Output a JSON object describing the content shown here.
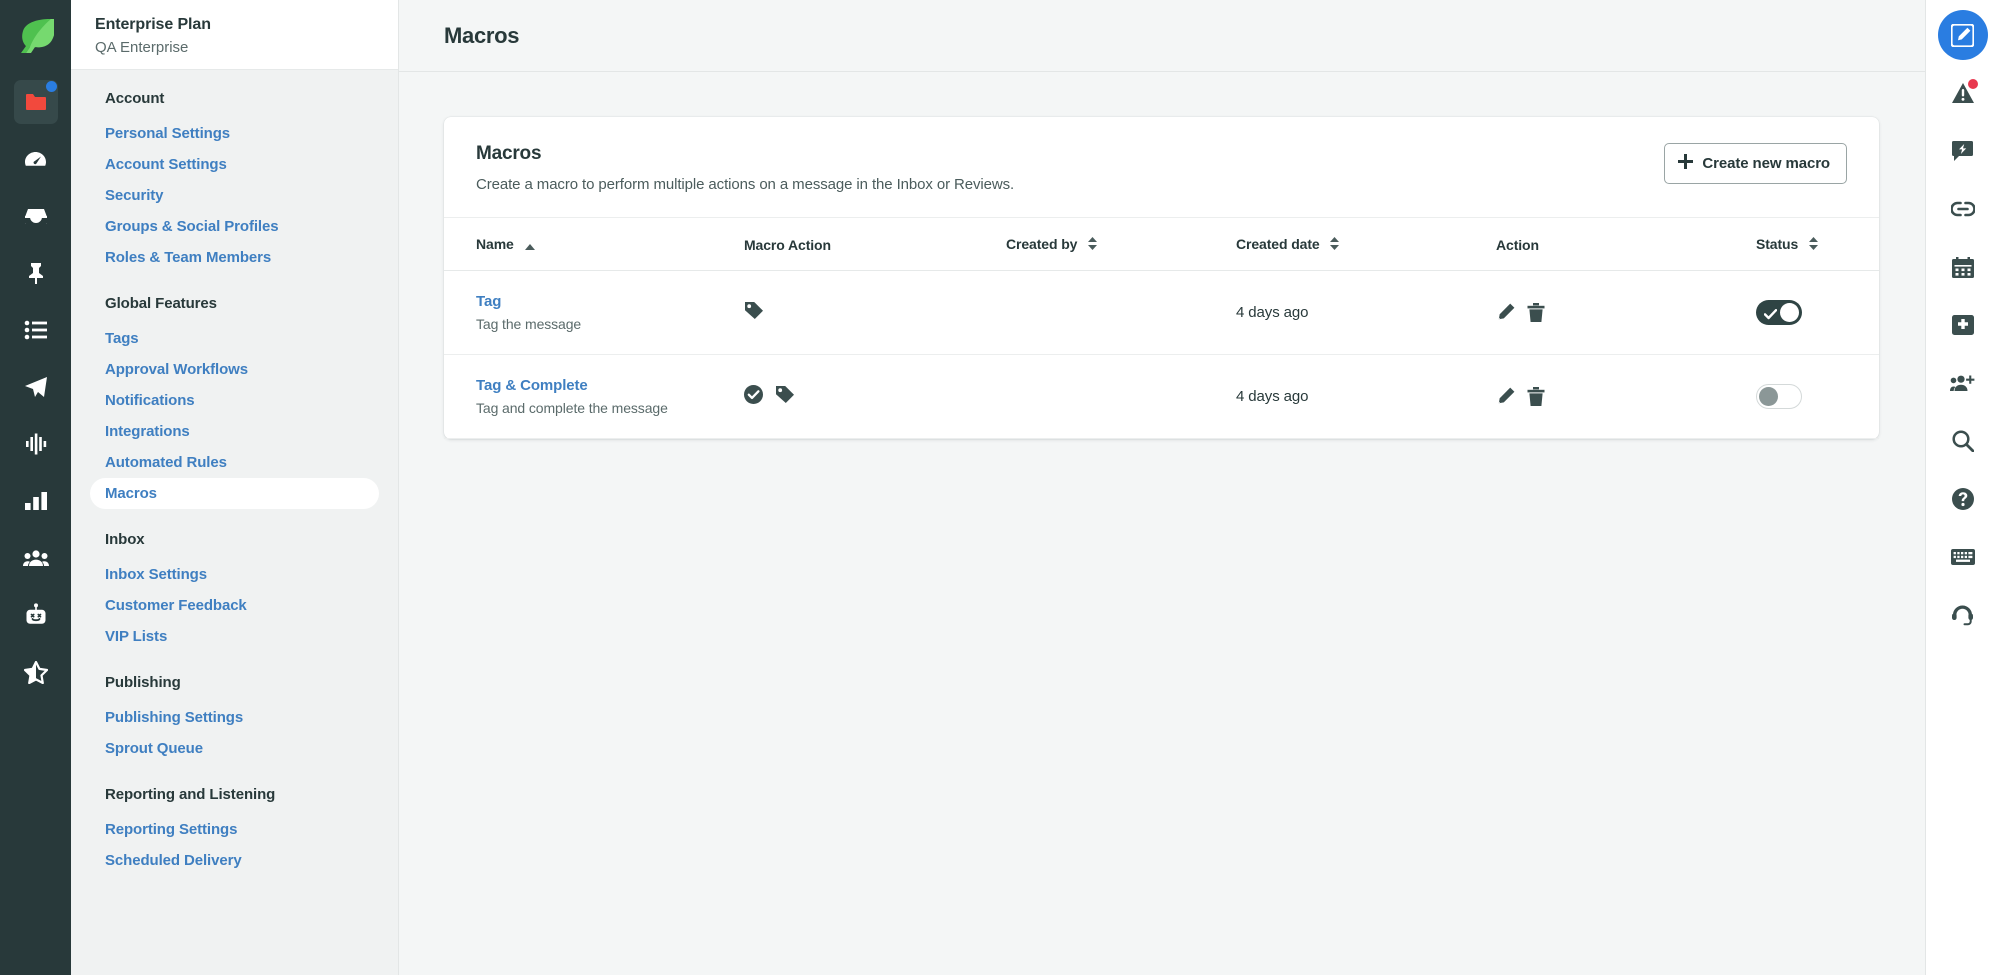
{
  "brand": {
    "logo_icon": "sprout-leaf-logo",
    "leaf_color": "#59cb59",
    "rail_bg": "#28393a",
    "link_color": "#3f7fc1",
    "accent_blue": "#2a7de1",
    "badge_red": "#e8384f"
  },
  "left_rail": {
    "items": [
      {
        "icon": "folder-icon",
        "name": "compose-folder",
        "active": true,
        "badge": "blue-dot"
      },
      {
        "icon": "speedometer-icon",
        "name": "dashboard",
        "active": false
      },
      {
        "icon": "inbox-icon",
        "name": "smart-inbox",
        "active": false
      },
      {
        "icon": "pin-icon",
        "name": "pinned",
        "active": false
      },
      {
        "icon": "list-icon",
        "name": "tasks",
        "active": false
      },
      {
        "icon": "paper-plane-icon",
        "name": "publishing",
        "active": false
      },
      {
        "icon": "waveform-icon",
        "name": "listening",
        "active": false
      },
      {
        "icon": "bar-chart-icon",
        "name": "reports",
        "active": false
      },
      {
        "icon": "people-icon",
        "name": "audience",
        "active": false
      },
      {
        "icon": "bot-icon",
        "name": "bots",
        "active": false
      },
      {
        "icon": "half-star-icon",
        "name": "reviews",
        "active": false
      }
    ]
  },
  "sidebar": {
    "plan_title": "Enterprise Plan",
    "plan_subtitle": "QA Enterprise",
    "groups": [
      {
        "title": "Account",
        "items": [
          {
            "label": "Personal Settings",
            "selected": false
          },
          {
            "label": "Account Settings",
            "selected": false
          },
          {
            "label": "Security",
            "selected": false
          },
          {
            "label": "Groups & Social Profiles",
            "selected": false
          },
          {
            "label": "Roles & Team Members",
            "selected": false
          }
        ]
      },
      {
        "title": "Global Features",
        "items": [
          {
            "label": "Tags",
            "selected": false
          },
          {
            "label": "Approval Workflows",
            "selected": false
          },
          {
            "label": "Notifications",
            "selected": false
          },
          {
            "label": "Integrations",
            "selected": false
          },
          {
            "label": "Automated Rules",
            "selected": false
          },
          {
            "label": "Macros",
            "selected": true
          }
        ]
      },
      {
        "title": "Inbox",
        "items": [
          {
            "label": "Inbox Settings",
            "selected": false
          },
          {
            "label": "Customer Feedback",
            "selected": false
          },
          {
            "label": "VIP Lists",
            "selected": false
          }
        ]
      },
      {
        "title": "Publishing",
        "items": [
          {
            "label": "Publishing Settings",
            "selected": false
          },
          {
            "label": "Sprout Queue",
            "selected": false
          }
        ]
      },
      {
        "title": "Reporting and Listening",
        "items": [
          {
            "label": "Reporting Settings",
            "selected": false
          },
          {
            "label": "Scheduled Delivery",
            "selected": false
          }
        ]
      }
    ]
  },
  "topbar": {
    "title": "Macros"
  },
  "card": {
    "title": "Macros",
    "description": "Create a macro to perform multiple actions on a message in the Inbox or Reviews.",
    "create_button": {
      "label": "Create new macro",
      "icon": "plus-icon"
    }
  },
  "table": {
    "columns": [
      {
        "label": "Name",
        "sort": "asc",
        "name": "col-name"
      },
      {
        "label": "Macro Action",
        "sort": "none",
        "name": "col-macro-action"
      },
      {
        "label": "Created by",
        "sort": "both",
        "name": "col-created-by"
      },
      {
        "label": "Created date",
        "sort": "both",
        "name": "col-created-date"
      },
      {
        "label": "Action",
        "sort": "none",
        "name": "col-action"
      },
      {
        "label": "Status",
        "sort": "both",
        "name": "col-status"
      }
    ],
    "rows": [
      {
        "name": "Tag",
        "description": "Tag the message",
        "macro_actions": [
          "tag-icon"
        ],
        "created_by": "",
        "created_date": "4 days ago",
        "actions": [
          "edit-pencil-icon",
          "trash-icon"
        ],
        "status_enabled": true
      },
      {
        "name": "Tag & Complete",
        "description": "Tag and complete the message",
        "macro_actions": [
          "check-circle-icon",
          "tag-icon"
        ],
        "created_by": "",
        "created_date": "4 days ago",
        "actions": [
          "edit-pencil-icon",
          "trash-icon"
        ],
        "status_enabled": false
      }
    ]
  },
  "right_rail": {
    "items": [
      {
        "icon": "compose-pencil-icon",
        "name": "compose",
        "active": true
      },
      {
        "icon": "alert-triangle-icon",
        "name": "alerts",
        "active": false,
        "badge": "red-dot"
      },
      {
        "icon": "chat-bolt-icon",
        "name": "messages",
        "active": false
      },
      {
        "icon": "link-icon",
        "name": "links",
        "active": false
      },
      {
        "icon": "calendar-icon",
        "name": "calendar",
        "active": false
      },
      {
        "icon": "plus-box-icon",
        "name": "add",
        "active": false
      },
      {
        "icon": "add-people-icon",
        "name": "invite",
        "active": false
      },
      {
        "icon": "search-icon",
        "name": "search",
        "active": false
      },
      {
        "icon": "help-circle-icon",
        "name": "help",
        "active": false
      },
      {
        "icon": "keyboard-icon",
        "name": "shortcuts",
        "active": false
      },
      {
        "icon": "headset-icon",
        "name": "support",
        "active": false
      }
    ]
  }
}
